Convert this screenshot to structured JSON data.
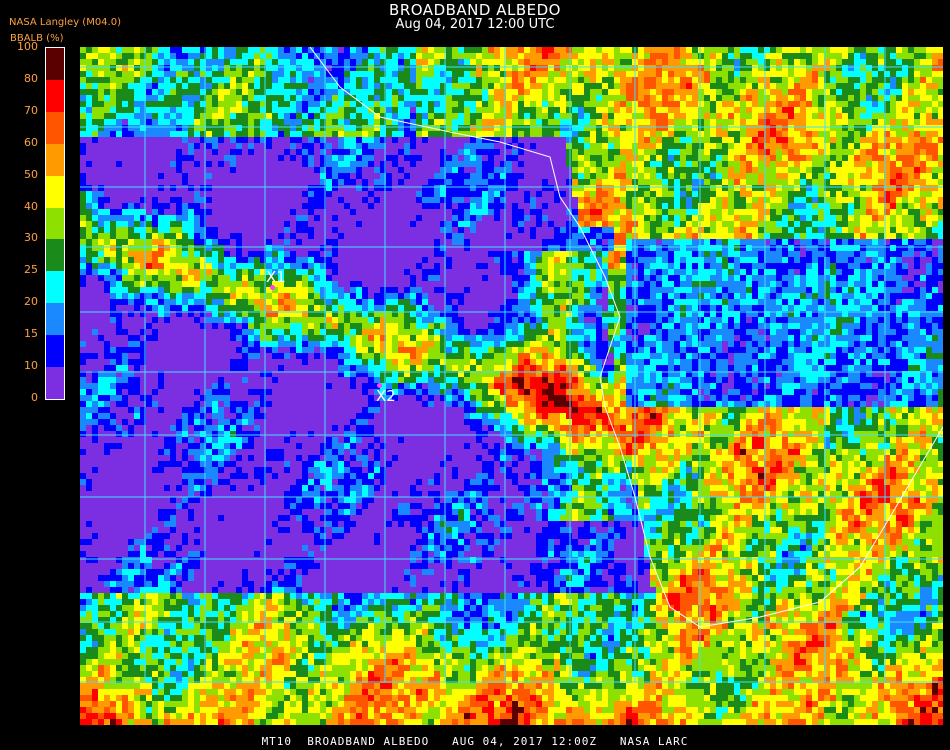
{
  "header": {
    "title": "BROADBAND ALBEDO",
    "subtitle": "Aug 04, 2017 12:00 UTC",
    "source": "NASA Langley (M04.0)"
  },
  "legend": {
    "units_label": "BBALB (%)",
    "ticks": [
      "100",
      "80",
      "70",
      "60",
      "50",
      "40",
      "30",
      "25",
      "20",
      "15",
      "10",
      "0"
    ],
    "bands": [
      {
        "from": 80,
        "to": 100,
        "color": "#5a0000"
      },
      {
        "from": 70,
        "to": 80,
        "color": "#ff0000"
      },
      {
        "from": 60,
        "to": 70,
        "color": "#ff5500"
      },
      {
        "from": 50,
        "to": 60,
        "color": "#ff9a00"
      },
      {
        "from": 40,
        "to": 50,
        "color": "#ffff00"
      },
      {
        "from": 30,
        "to": 40,
        "color": "#8ee000"
      },
      {
        "from": 25,
        "to": 30,
        "color": "#1a8a1a"
      },
      {
        "from": 20,
        "to": 25,
        "color": "#00ffff"
      },
      {
        "from": 15,
        "to": 20,
        "color": "#1a88ff"
      },
      {
        "from": 10,
        "to": 15,
        "color": "#0000ff"
      },
      {
        "from": 0,
        "to": 10,
        "color": "#7b2fe0"
      }
    ]
  },
  "markers": [
    {
      "label": "X1"
    },
    {
      "label": "X2"
    }
  ],
  "colors": {
    "grid": "#40e0ff",
    "coast": "#ffffff",
    "ocean": "#7b2fe0"
  },
  "footer": {
    "text": "MT10  BROADBAND ALBEDO   AUG 04, 2017 12:00Z   NASA LARC"
  }
}
